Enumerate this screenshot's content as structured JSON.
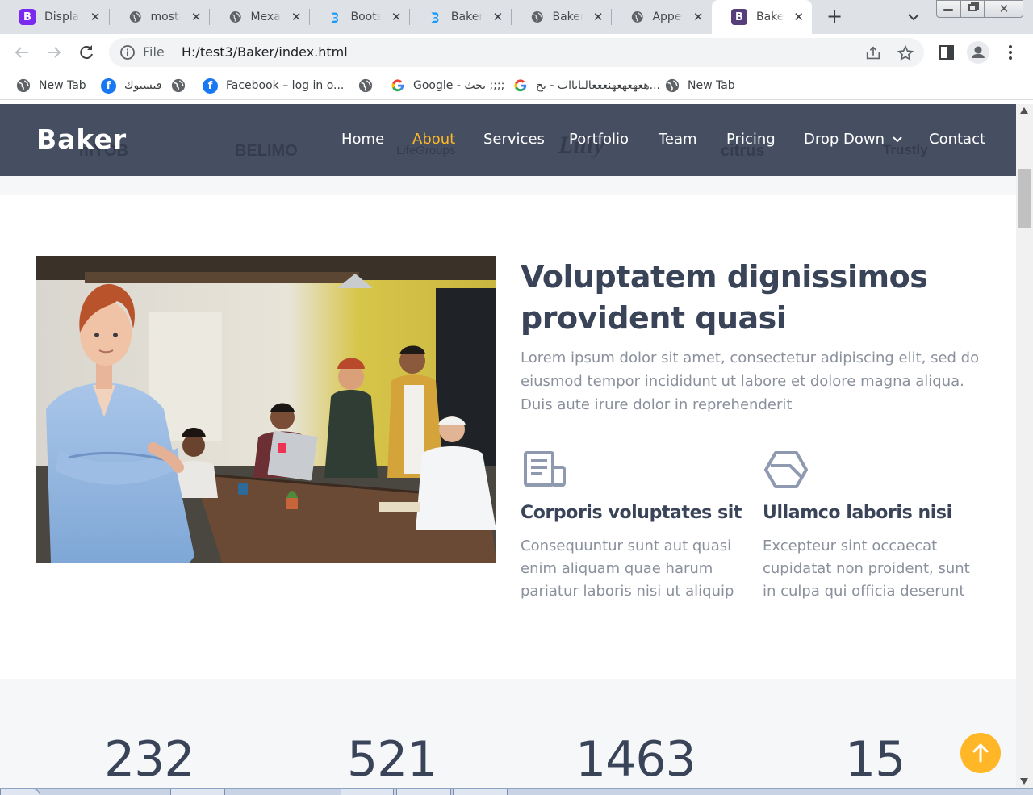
{
  "browser": {
    "tabs": [
      {
        "favicon": "bootstrap-icon",
        "title": "Display"
      },
      {
        "favicon": "globe-icon",
        "title": "mostafa"
      },
      {
        "favicon": "globe-icon",
        "title": "Mexant"
      },
      {
        "favicon": "bootstrapmade-icon",
        "title": "Bootstrap"
      },
      {
        "favicon": "bootstrapmade-icon",
        "title": "Baker"
      },
      {
        "favicon": "globe-icon",
        "title": "Baker"
      },
      {
        "favicon": "globe-icon",
        "title": "Append"
      },
      {
        "favicon": "bootstrap-icon",
        "title": "Baker"
      }
    ],
    "active_tab_index": 7,
    "url_scheme": "File",
    "url": "H:/test3/Baker/index.html",
    "bookmarks": [
      {
        "icon": "globe-icon",
        "label": "New Tab"
      },
      {
        "icon": "facebook-icon",
        "label": "فيسبوك"
      },
      {
        "icon": "globe-icon",
        "label": ""
      },
      {
        "icon": "facebook-icon",
        "label": "Facebook – log in o..."
      },
      {
        "icon": "globe-icon",
        "label": ""
      },
      {
        "icon": "google-icon",
        "label": "Google - بحث ;;;;"
      },
      {
        "icon": "google-icon",
        "label": "هعهعهعهنعععالبابااب - بح..."
      },
      {
        "icon": "globe-icon",
        "label": "New Tab"
      }
    ]
  },
  "site": {
    "brand": "Baker",
    "nav": [
      "Home",
      "About",
      "Services",
      "Portfolio",
      "Team",
      "Pricing",
      "Drop Down",
      "Contact"
    ],
    "active_nav": "About",
    "client_logos": [
      "mYOB",
      "BELIMO",
      "LifeGroups",
      "Lilly",
      "citrus",
      "Trustly"
    ],
    "about": {
      "title": "Voluptatem dignissimos provident quasi",
      "lead": "Lorem ipsum dolor sit amet, consectetur adipiscing elit, sed do eiusmod tempor incididunt ut labore et dolore magna aliqua. Duis aute irure dolor in reprehenderit",
      "features": [
        {
          "icon": "receipt-icon",
          "title": "Corporis voluptates sit",
          "text": "Consequuntur sunt aut quasi enim aliquam quae harum pariatur laboris nisi ut aliquip"
        },
        {
          "icon": "hexagon-cube-icon",
          "title": "Ullamco laboris nisi",
          "text": "Excepteur sint occaecat cupidatat non proident, sunt in culpa qui officia deserunt"
        }
      ]
    },
    "counts": [
      "232",
      "521",
      "1463",
      "15"
    ]
  },
  "colors": {
    "header_bg": "#3e485c",
    "accent": "#ffb727",
    "heading": "#3a4459",
    "body_text": "#8a909c"
  }
}
